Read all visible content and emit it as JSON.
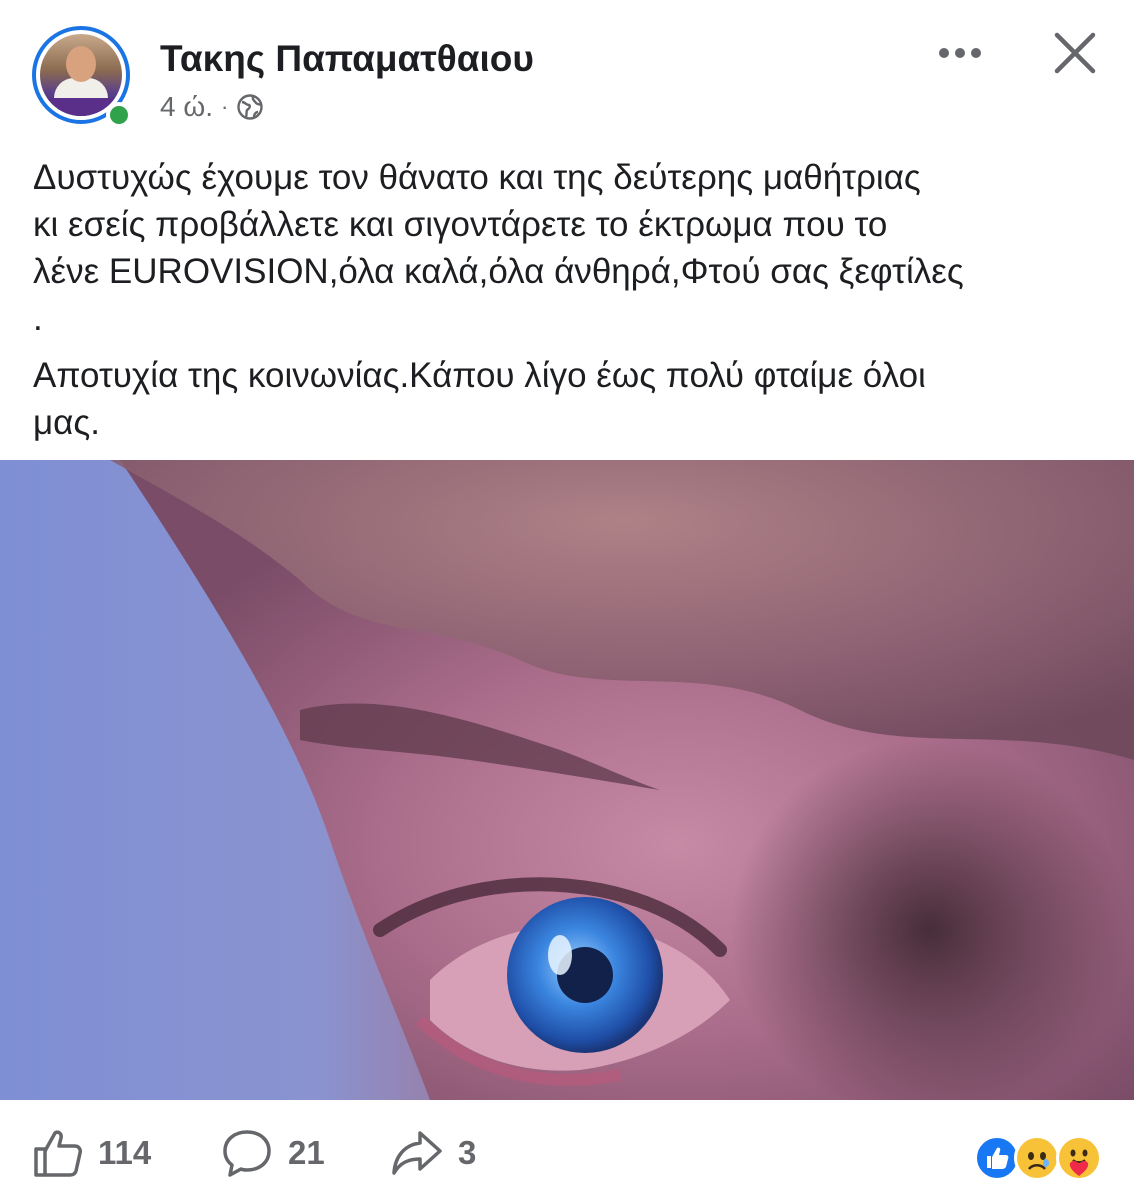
{
  "post": {
    "author": "Τακης Παπαματθαιου",
    "time": "4 ώ.",
    "separator": "·",
    "audience_icon": "globe-icon",
    "text_paragraph_1": "Δυστυχώς έχουμε τον θάνατο και της δεύτερης μαθήτριας\nκι εσείς προβάλλετε και σιγοντάρετε το έκτρωμα που το\nλένε EUROVISION,όλα καλά,όλα άνθηρά,Φτού σας ξεφτίλες\n.",
    "text_paragraph_2": "Αποτυχία της κοινωνίας.Κάπου λίγο έως πολύ φταίμε όλοι\nμας."
  },
  "header_controls": {
    "more_icon": "more-options-icon",
    "close_icon": "close-icon"
  },
  "footer": {
    "likes": "114",
    "comments": "21",
    "shares": "3",
    "reactions": [
      "like",
      "sad",
      "care"
    ]
  },
  "colors": {
    "accent": "#1b74e4",
    "online": "#31a24c",
    "text": "#1c1e21",
    "muted": "#65676b"
  }
}
